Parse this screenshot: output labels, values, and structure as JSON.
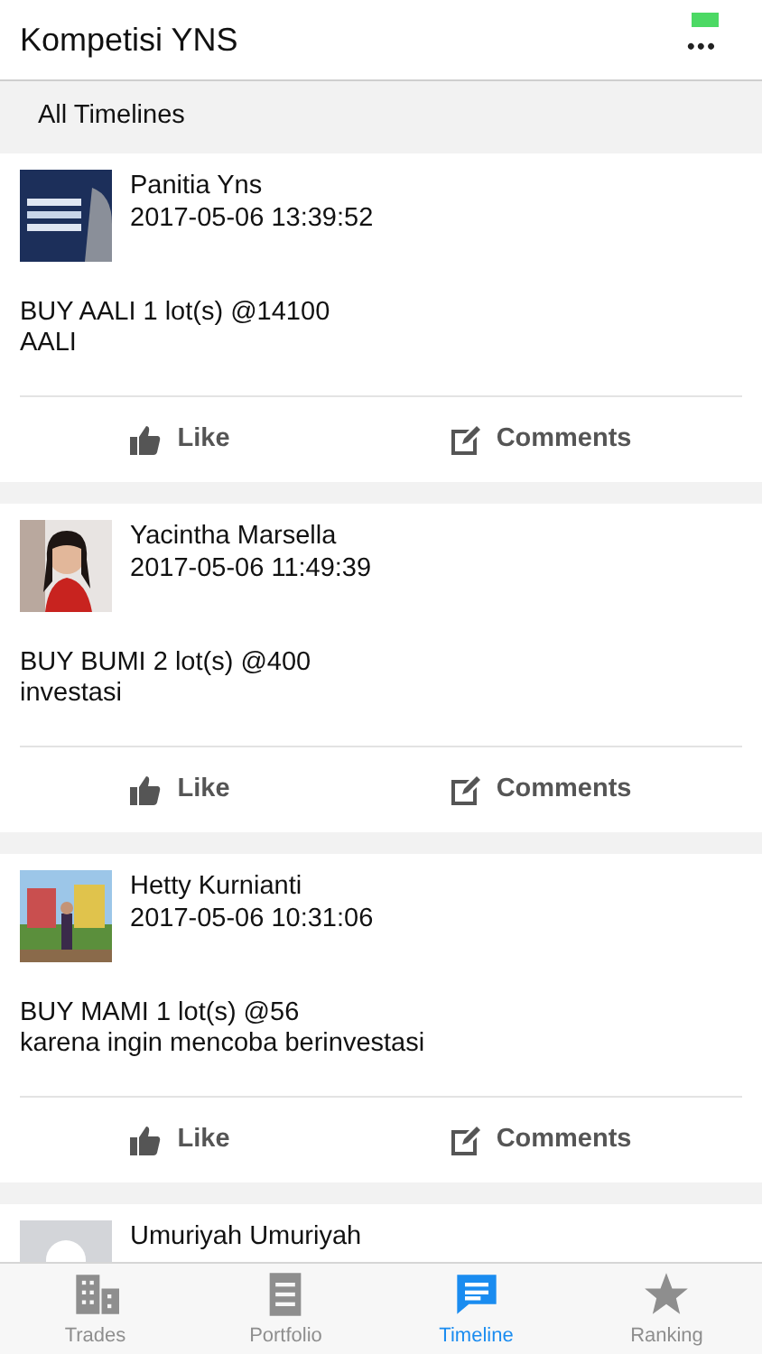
{
  "header": {
    "title": "Kompetisi YNS",
    "menu": "•••"
  },
  "section": {
    "title": "All Timelines"
  },
  "posts": [
    {
      "name": "Panitia Yns",
      "time": "2017-05-06 13:39:52",
      "lines": [
        "BUY AALI 1 lot(s) @14100",
        "AALI"
      ],
      "like": "Like",
      "comments": "Comments"
    },
    {
      "name": "Yacintha Marsella",
      "time": "2017-05-06 11:49:39",
      "lines": [
        "BUY BUMI 2 lot(s) @400",
        "investasi"
      ],
      "like": "Like",
      "comments": "Comments"
    },
    {
      "name": "Hetty Kurnianti",
      "time": "2017-05-06 10:31:06",
      "lines": [
        "BUY MAMI 1 lot(s) @56",
        "karena ingin mencoba berinvestasi"
      ],
      "like": "Like",
      "comments": "Comments"
    },
    {
      "avatar": {
        "kind": "placeholder"
      },
      "name": "Umuriyah Umuriyah"
    }
  ],
  "tabs": [
    {
      "kind": "building",
      "label": "Trades",
      "selected": false
    },
    {
      "kind": "document",
      "label": "Portfolio",
      "selected": false
    },
    {
      "kind": "chat",
      "label": "Timeline",
      "selected": true
    },
    {
      "kind": "star",
      "label": "Ranking",
      "selected": false
    }
  ]
}
